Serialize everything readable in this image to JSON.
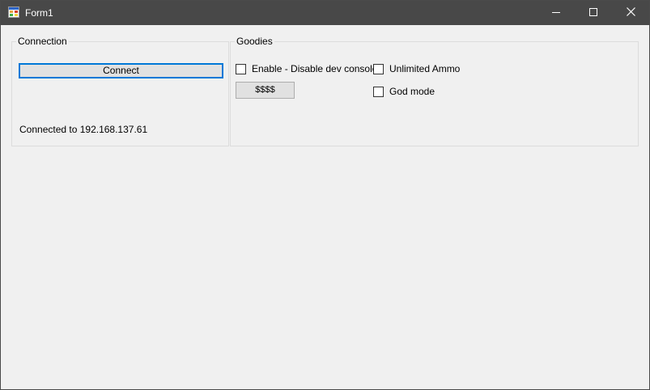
{
  "window": {
    "title": "Form1",
    "icon": "form-app-icon",
    "controls": {
      "minimize_icon": "minimize-icon",
      "maximize_icon": "maximize-icon",
      "close_icon": "close-icon"
    },
    "colors": {
      "titlebar": "#484848",
      "client": "#f0f0f0",
      "focus_accent": "#0078d7"
    }
  },
  "connection": {
    "legend": "Connection",
    "connect_label": "Connect",
    "status": "Connected to 192.168.137.61"
  },
  "goodies": {
    "legend": "Goodies",
    "dev_console": {
      "label": "Enable - Disable dev console",
      "checked": false
    },
    "money_label": "$$$$",
    "unlimited_ammo": {
      "label": "Unlimited Ammo",
      "checked": false
    },
    "god_mode": {
      "label": "God mode",
      "checked": false
    }
  }
}
